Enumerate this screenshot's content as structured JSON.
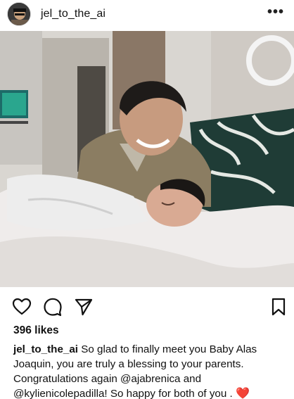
{
  "post": {
    "username": "jel_to_the_ai",
    "more_icon": "ellipsis-icon",
    "likes": "396 likes",
    "caption": {
      "username": "jel_to_the_ai",
      "text_1": " So glad to finally meet you Baby Alas Joaquin, you are truly a blessing to your parents. Congratulations again ",
      "mention_1": "@ajabrenica",
      "text_2": " and ",
      "mention_2": "@kylienicolepadilla",
      "text_3": "! So happy for both of you . ",
      "emoji": "❤️"
    }
  },
  "actions": {
    "like_icon": "heart-outline-icon",
    "comment_icon": "comment-icon",
    "share_icon": "send-icon",
    "save_icon": "bookmark-icon"
  }
}
